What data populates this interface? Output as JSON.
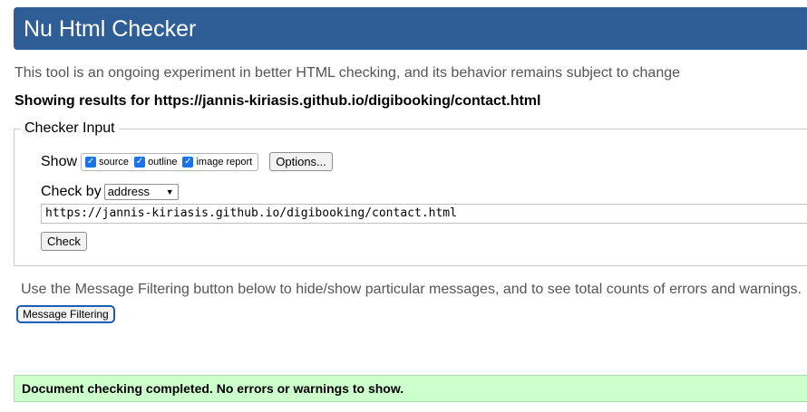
{
  "header": {
    "title": "Nu Html Checker"
  },
  "intro": "This tool is an ongoing experiment in better HTML checking, and its behavior remains subject to change",
  "results_heading": "Showing results for https://jannis-kiriasis.github.io/digibooking/contact.html",
  "checker_input": {
    "legend": "Checker Input",
    "show_label": "Show",
    "checkboxes": [
      {
        "label": "source",
        "checked": true
      },
      {
        "label": "outline",
        "checked": true
      },
      {
        "label": "image report",
        "checked": true
      }
    ],
    "options_button": "Options...",
    "check_by_label": "Check by",
    "check_by_value": "address",
    "url_value": "https://jannis-kiriasis.github.io/digibooking/contact.html",
    "check_button": "Check"
  },
  "filtering": {
    "text": "Use the Message Filtering button below to hide/show particular messages, and to see total counts of errors and warnings.",
    "button": "Message Filtering"
  },
  "status": {
    "message": "Document checking completed. No errors or warnings to show.",
    "color": "#ccffcc"
  },
  "colors": {
    "header_bg": "#2f5e96",
    "checkbox_accent": "#1a73e8"
  }
}
